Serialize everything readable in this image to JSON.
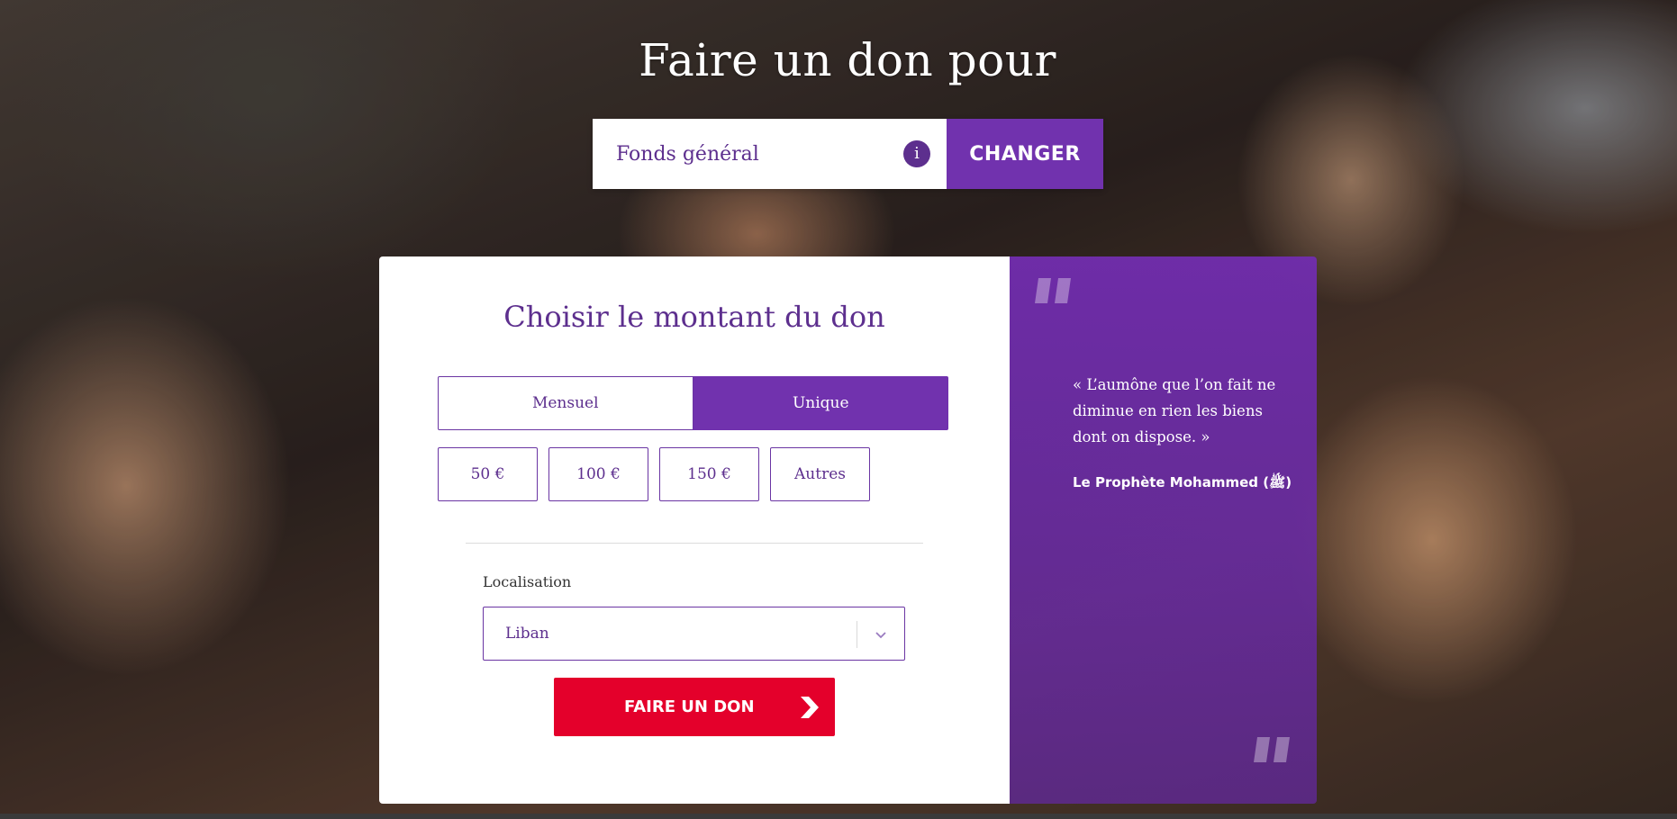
{
  "hero": {
    "title": "Faire un don pour"
  },
  "fund_selector": {
    "selected_fund": "Fonds général",
    "info_label": "i",
    "change_label": "CHANGER"
  },
  "donation_form": {
    "title": "Choisir le montant du don",
    "frequency": {
      "options": [
        "Mensuel",
        "Unique"
      ],
      "selected": "Unique"
    },
    "amounts": [
      "50 €",
      "100 €",
      "150 €",
      "Autres"
    ],
    "location": {
      "label": "Localisation",
      "selected": "Liban"
    },
    "submit_label": "FAIRE UN DON"
  },
  "quote": {
    "text": "« L’aumône que l’on fait ne diminue en rien les biens dont on dispose. »",
    "author": "Le Prophète Mohammed (ﷺ)"
  },
  "colors": {
    "brand_purple": "#7132ae",
    "text_purple": "#5d2f8e",
    "donate_red": "#e4002b"
  }
}
